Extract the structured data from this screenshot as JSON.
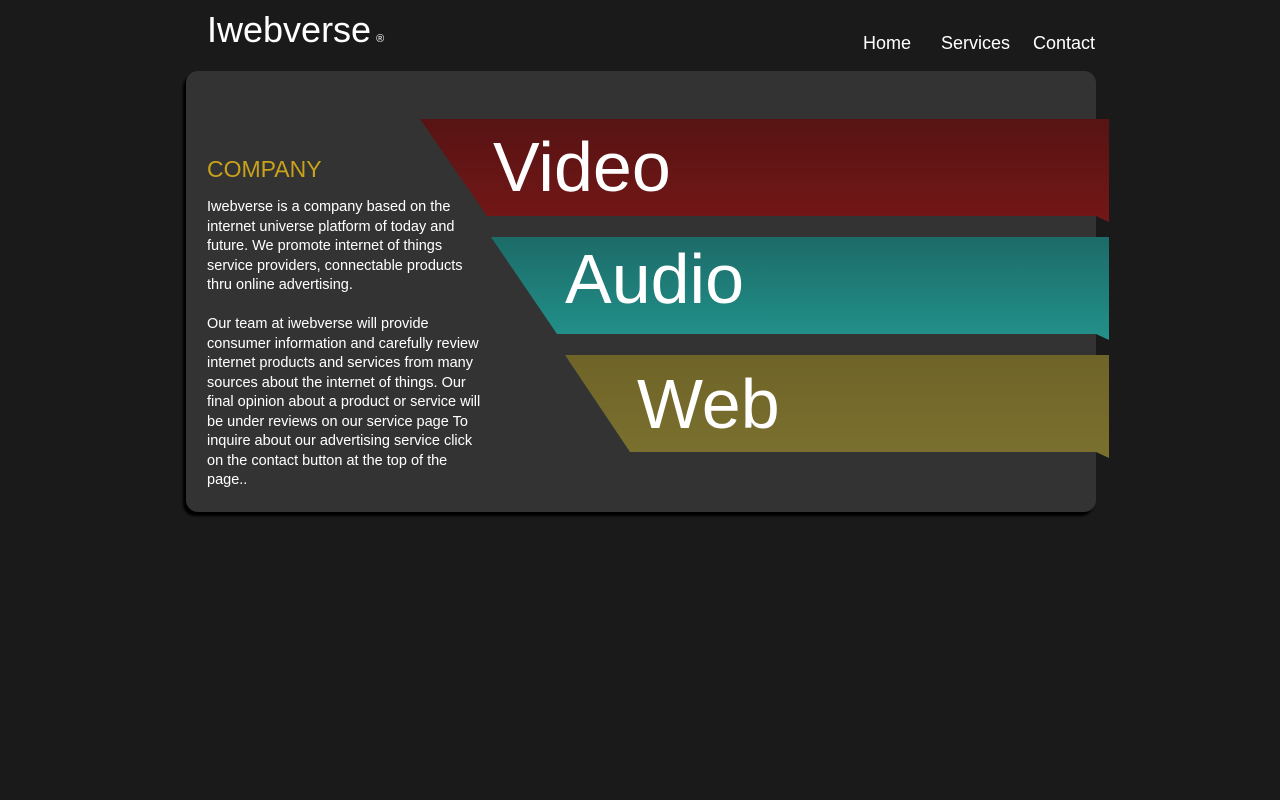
{
  "header": {
    "logo_text": "Iwebverse",
    "logo_mark": "®"
  },
  "nav": {
    "home": "Home",
    "services": "Services",
    "contact": "Contact"
  },
  "company": {
    "title": "COMPANY",
    "paragraph_1": "Iwebverse is a company based on the internet universe platform of today and future. We promote internet of things service providers, connectable products thru online advertising.",
    "paragraph_2": "Our team at iwebverse will provide consumer information and carefully review internet products and services from many sources about the internet of things. Our final opinion about a product or service will be under reviews on our service page To inquire about our advertising service click on the contact button at the top of the page.."
  },
  "banners": [
    {
      "label": "Video",
      "color": "#6b1515"
    },
    {
      "label": "Audio",
      "color": "#1e8079"
    },
    {
      "label": "Web",
      "color": "#746a2b"
    }
  ]
}
